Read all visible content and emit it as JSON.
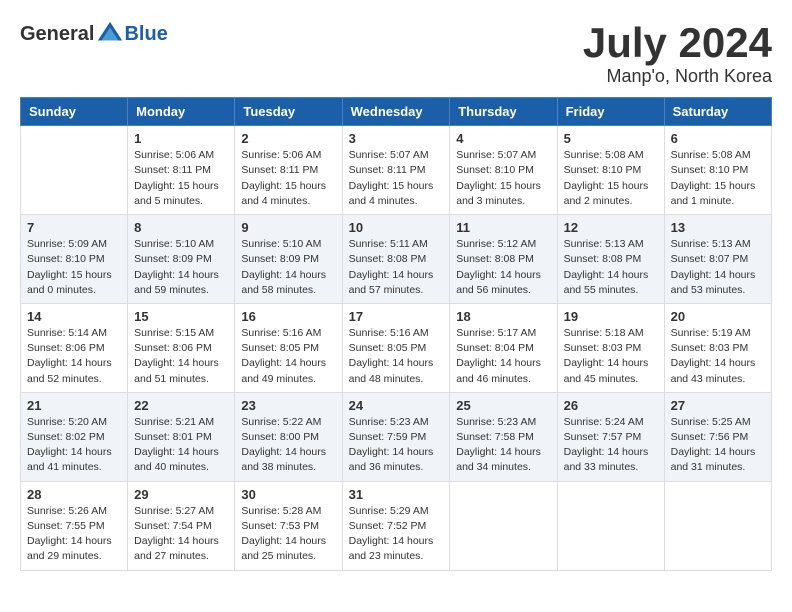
{
  "header": {
    "logo_general": "General",
    "logo_blue": "Blue",
    "month_year": "July 2024",
    "location": "Manp'o, North Korea"
  },
  "weekdays": [
    "Sunday",
    "Monday",
    "Tuesday",
    "Wednesday",
    "Thursday",
    "Friday",
    "Saturday"
  ],
  "weeks": [
    [
      {
        "day": null,
        "info": null
      },
      {
        "day": "1",
        "info": "Sunrise: 5:06 AM\nSunset: 8:11 PM\nDaylight: 15 hours\nand 5 minutes."
      },
      {
        "day": "2",
        "info": "Sunrise: 5:06 AM\nSunset: 8:11 PM\nDaylight: 15 hours\nand 4 minutes."
      },
      {
        "day": "3",
        "info": "Sunrise: 5:07 AM\nSunset: 8:11 PM\nDaylight: 15 hours\nand 4 minutes."
      },
      {
        "day": "4",
        "info": "Sunrise: 5:07 AM\nSunset: 8:10 PM\nDaylight: 15 hours\nand 3 minutes."
      },
      {
        "day": "5",
        "info": "Sunrise: 5:08 AM\nSunset: 8:10 PM\nDaylight: 15 hours\nand 2 minutes."
      },
      {
        "day": "6",
        "info": "Sunrise: 5:08 AM\nSunset: 8:10 PM\nDaylight: 15 hours\nand 1 minute."
      }
    ],
    [
      {
        "day": "7",
        "info": "Sunrise: 5:09 AM\nSunset: 8:10 PM\nDaylight: 15 hours\nand 0 minutes."
      },
      {
        "day": "8",
        "info": "Sunrise: 5:10 AM\nSunset: 8:09 PM\nDaylight: 14 hours\nand 59 minutes."
      },
      {
        "day": "9",
        "info": "Sunrise: 5:10 AM\nSunset: 8:09 PM\nDaylight: 14 hours\nand 58 minutes."
      },
      {
        "day": "10",
        "info": "Sunrise: 5:11 AM\nSunset: 8:08 PM\nDaylight: 14 hours\nand 57 minutes."
      },
      {
        "day": "11",
        "info": "Sunrise: 5:12 AM\nSunset: 8:08 PM\nDaylight: 14 hours\nand 56 minutes."
      },
      {
        "day": "12",
        "info": "Sunrise: 5:13 AM\nSunset: 8:08 PM\nDaylight: 14 hours\nand 55 minutes."
      },
      {
        "day": "13",
        "info": "Sunrise: 5:13 AM\nSunset: 8:07 PM\nDaylight: 14 hours\nand 53 minutes."
      }
    ],
    [
      {
        "day": "14",
        "info": "Sunrise: 5:14 AM\nSunset: 8:06 PM\nDaylight: 14 hours\nand 52 minutes."
      },
      {
        "day": "15",
        "info": "Sunrise: 5:15 AM\nSunset: 8:06 PM\nDaylight: 14 hours\nand 51 minutes."
      },
      {
        "day": "16",
        "info": "Sunrise: 5:16 AM\nSunset: 8:05 PM\nDaylight: 14 hours\nand 49 minutes."
      },
      {
        "day": "17",
        "info": "Sunrise: 5:16 AM\nSunset: 8:05 PM\nDaylight: 14 hours\nand 48 minutes."
      },
      {
        "day": "18",
        "info": "Sunrise: 5:17 AM\nSunset: 8:04 PM\nDaylight: 14 hours\nand 46 minutes."
      },
      {
        "day": "19",
        "info": "Sunrise: 5:18 AM\nSunset: 8:03 PM\nDaylight: 14 hours\nand 45 minutes."
      },
      {
        "day": "20",
        "info": "Sunrise: 5:19 AM\nSunset: 8:03 PM\nDaylight: 14 hours\nand 43 minutes."
      }
    ],
    [
      {
        "day": "21",
        "info": "Sunrise: 5:20 AM\nSunset: 8:02 PM\nDaylight: 14 hours\nand 41 minutes."
      },
      {
        "day": "22",
        "info": "Sunrise: 5:21 AM\nSunset: 8:01 PM\nDaylight: 14 hours\nand 40 minutes."
      },
      {
        "day": "23",
        "info": "Sunrise: 5:22 AM\nSunset: 8:00 PM\nDaylight: 14 hours\nand 38 minutes."
      },
      {
        "day": "24",
        "info": "Sunrise: 5:23 AM\nSunset: 7:59 PM\nDaylight: 14 hours\nand 36 minutes."
      },
      {
        "day": "25",
        "info": "Sunrise: 5:23 AM\nSunset: 7:58 PM\nDaylight: 14 hours\nand 34 minutes."
      },
      {
        "day": "26",
        "info": "Sunrise: 5:24 AM\nSunset: 7:57 PM\nDaylight: 14 hours\nand 33 minutes."
      },
      {
        "day": "27",
        "info": "Sunrise: 5:25 AM\nSunset: 7:56 PM\nDaylight: 14 hours\nand 31 minutes."
      }
    ],
    [
      {
        "day": "28",
        "info": "Sunrise: 5:26 AM\nSunset: 7:55 PM\nDaylight: 14 hours\nand 29 minutes."
      },
      {
        "day": "29",
        "info": "Sunrise: 5:27 AM\nSunset: 7:54 PM\nDaylight: 14 hours\nand 27 minutes."
      },
      {
        "day": "30",
        "info": "Sunrise: 5:28 AM\nSunset: 7:53 PM\nDaylight: 14 hours\nand 25 minutes."
      },
      {
        "day": "31",
        "info": "Sunrise: 5:29 AM\nSunset: 7:52 PM\nDaylight: 14 hours\nand 23 minutes."
      },
      {
        "day": null,
        "info": null
      },
      {
        "day": null,
        "info": null
      },
      {
        "day": null,
        "info": null
      }
    ]
  ]
}
